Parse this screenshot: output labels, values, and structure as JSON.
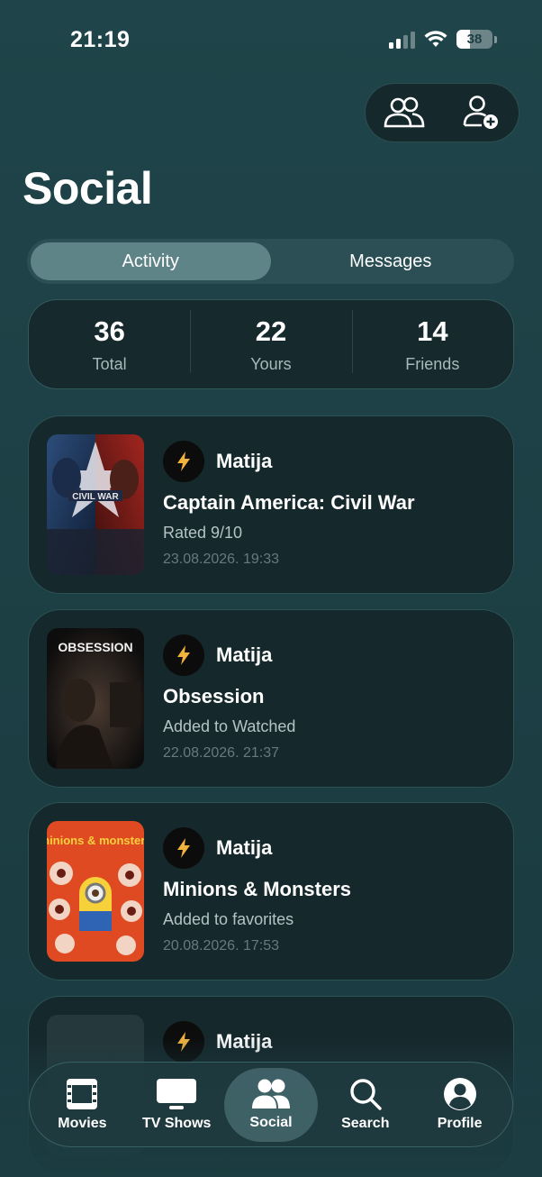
{
  "status_bar": {
    "time": "21:19",
    "battery": "38",
    "battery_level": 0.38
  },
  "header": {
    "title": "Social",
    "actions": [
      {
        "icon": "friends-icon"
      },
      {
        "icon": "add-friend-icon"
      }
    ]
  },
  "tabs": [
    {
      "label": "Activity",
      "active": true
    },
    {
      "label": "Messages",
      "active": false
    }
  ],
  "stats": [
    {
      "value": "36",
      "label": "Total"
    },
    {
      "value": "22",
      "label": "Yours"
    },
    {
      "value": "14",
      "label": "Friends"
    }
  ],
  "activities": [
    {
      "user": "Matija",
      "avatar_icon": "lightning-icon",
      "title": "Captain America: Civil War",
      "action": "Rated 9/10",
      "timestamp": "23.08.2026. 19:33",
      "poster_text": "CIVIL WAR"
    },
    {
      "user": "Matija",
      "avatar_icon": "lightning-icon",
      "title": "Obsession",
      "action": "Added to Watched",
      "timestamp": "22.08.2026. 21:37",
      "poster_text": "OBSESSION"
    },
    {
      "user": "Matija",
      "avatar_icon": "lightning-icon",
      "title": "Minions & Monsters",
      "action": "Added to favorites",
      "timestamp": "20.08.2026. 17:53",
      "poster_text": "minions & monsters"
    },
    {
      "user": "Matija",
      "avatar_icon": "lightning-icon",
      "title": "",
      "action": "",
      "timestamp": ""
    }
  ],
  "bottom_nav": [
    {
      "label": "Movies",
      "icon": "film-icon",
      "active": false
    },
    {
      "label": "TV Shows",
      "icon": "tv-icon",
      "active": false
    },
    {
      "label": "Social",
      "icon": "people-icon",
      "active": true
    },
    {
      "label": "Search",
      "icon": "search-icon",
      "active": false
    },
    {
      "label": "Profile",
      "icon": "profile-icon",
      "active": false
    }
  ],
  "colors": {
    "background": "#1d4046",
    "card": "#15282c",
    "accent_bolt": "#f2b33d",
    "active_tab": "#5f8488"
  }
}
